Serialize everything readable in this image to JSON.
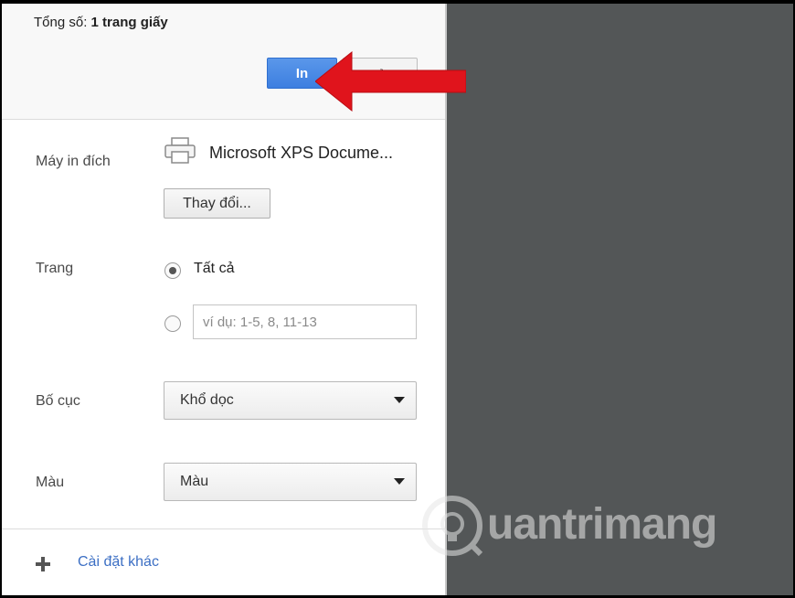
{
  "summary": {
    "total_label": "Tổng số:",
    "total_value": "1 trang giấy"
  },
  "actions": {
    "print_label": "In",
    "cancel_label": "Hủy"
  },
  "destination": {
    "label": "Máy in đích",
    "printer_name": "Microsoft XPS Docume...",
    "change_label": "Thay đổi..."
  },
  "pages": {
    "label": "Trang",
    "all_label": "Tất cả",
    "custom_placeholder": "ví dụ: 1-5, 8, 11-13"
  },
  "layout": {
    "label": "Bố cục",
    "selected": "Khổ dọc"
  },
  "color": {
    "label": "Màu",
    "selected": "Màu"
  },
  "more": {
    "label": "Cài đặt khác"
  },
  "watermark": {
    "text": "uantrimang"
  },
  "colors": {
    "accent": "#4a8af4",
    "arrow": "#e0141c",
    "preview_bg": "#535657",
    "link": "#3c6fc4"
  }
}
